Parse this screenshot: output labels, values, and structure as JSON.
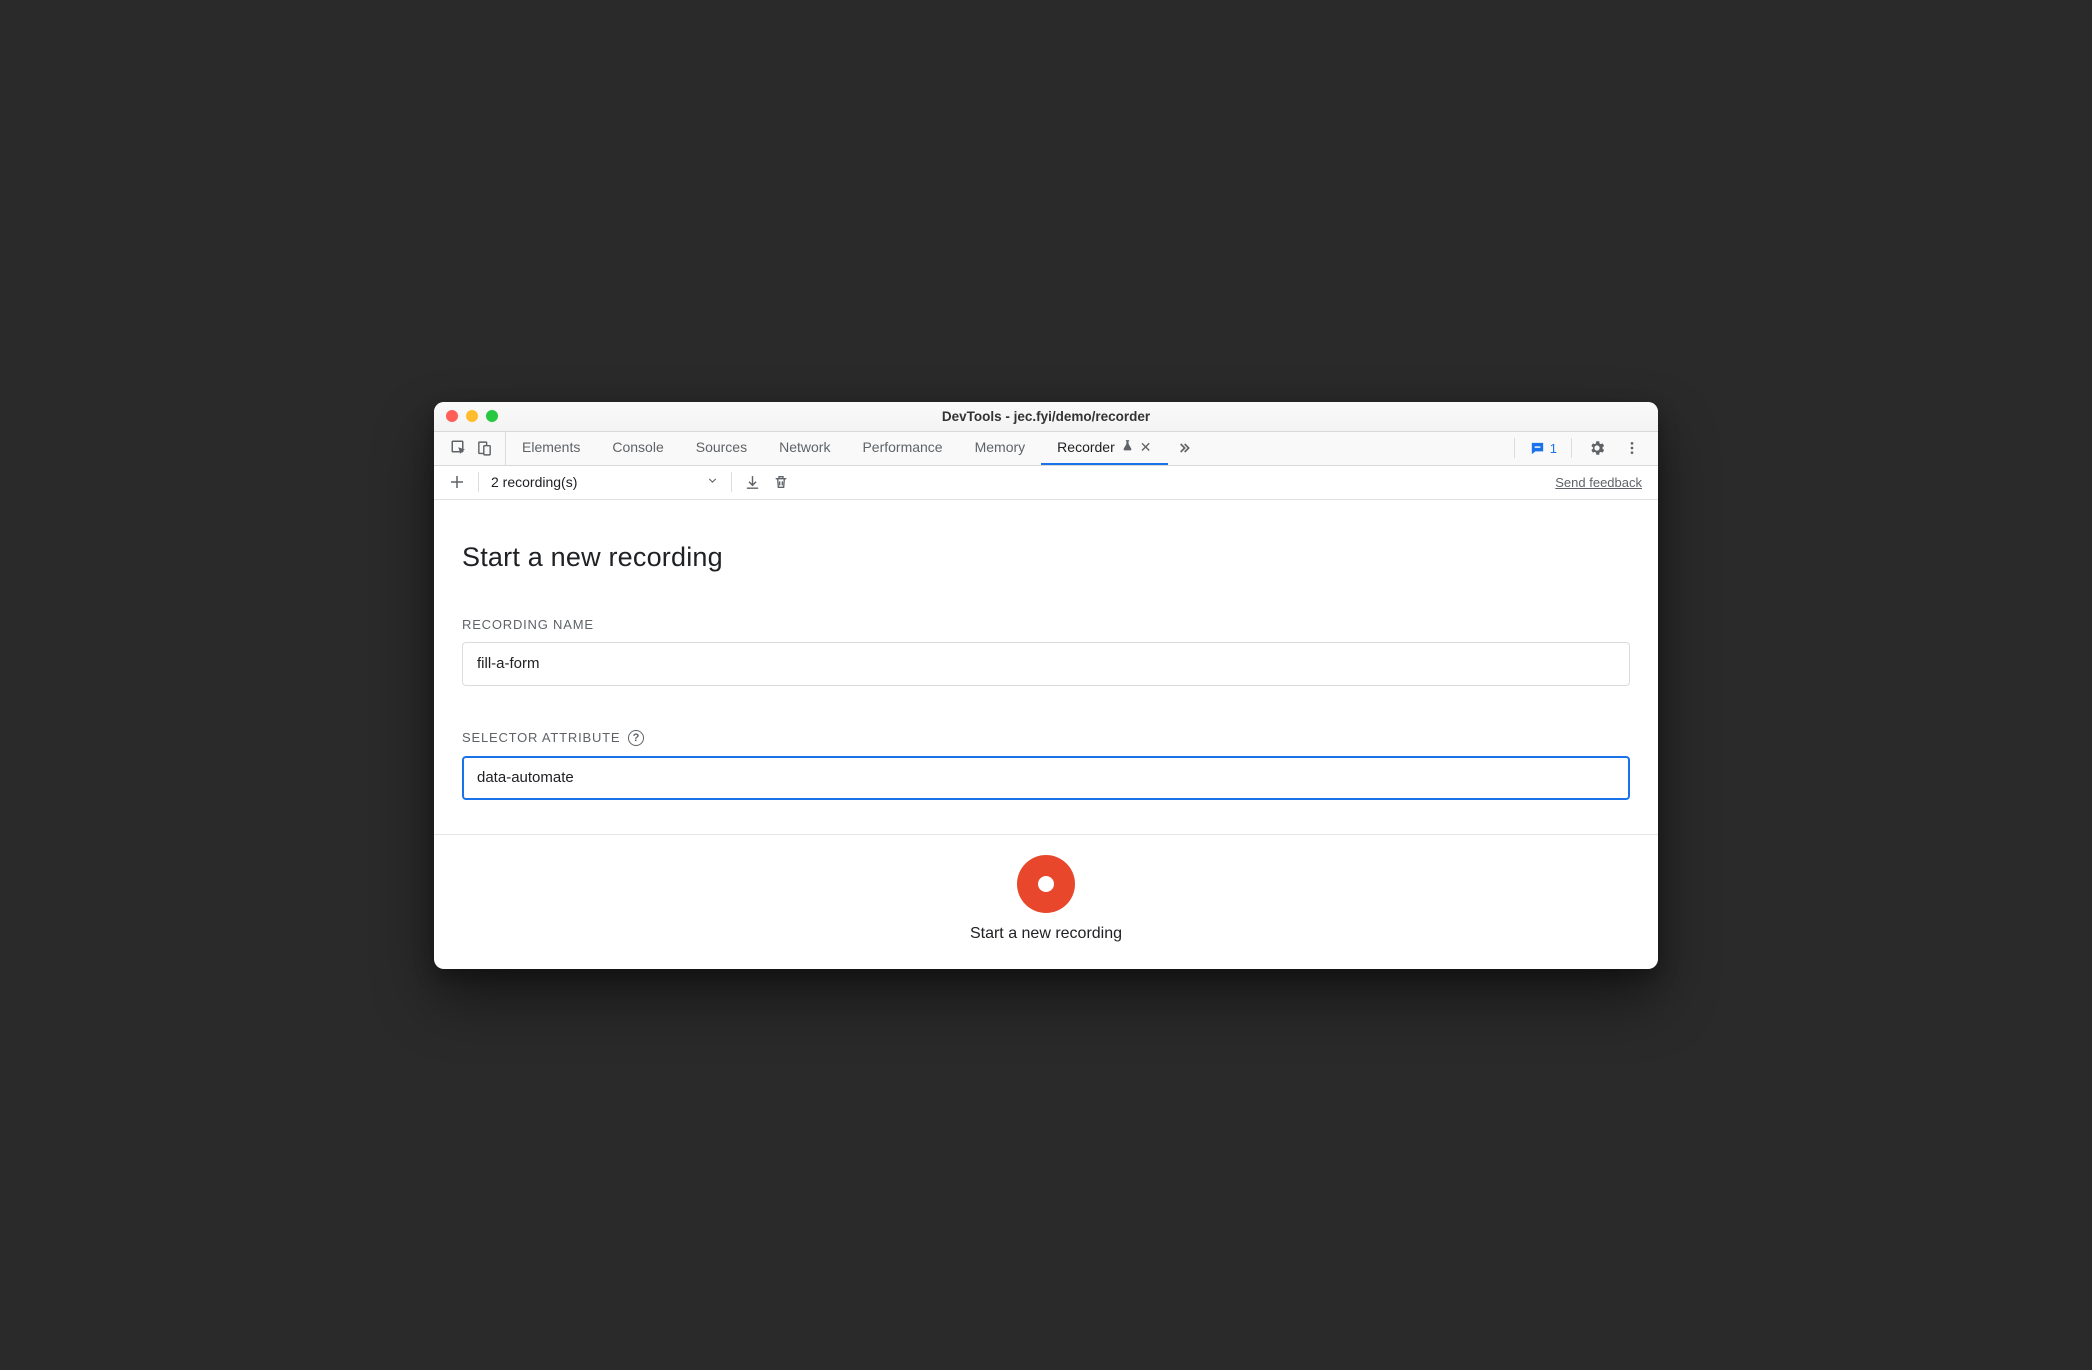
{
  "window": {
    "title": "DevTools - jec.fyi/demo/recorder"
  },
  "tabs": {
    "items": [
      {
        "label": "Elements",
        "active": false
      },
      {
        "label": "Console",
        "active": false
      },
      {
        "label": "Sources",
        "active": false
      },
      {
        "label": "Network",
        "active": false
      },
      {
        "label": "Performance",
        "active": false
      },
      {
        "label": "Memory",
        "active": false
      },
      {
        "label": "Recorder",
        "active": true,
        "experimental": true,
        "closable": true
      }
    ],
    "issue_count": "1"
  },
  "toolbar": {
    "recordings_label": "2 recording(s)",
    "feedback_label": "Send feedback"
  },
  "main": {
    "page_title": "Start a new recording",
    "recording_name_label": "RECORDING NAME",
    "recording_name_value": "fill-a-form",
    "selector_attribute_label": "SELECTOR ATTRIBUTE",
    "selector_attribute_value": "data-automate"
  },
  "bottom": {
    "start_label": "Start a new recording"
  }
}
